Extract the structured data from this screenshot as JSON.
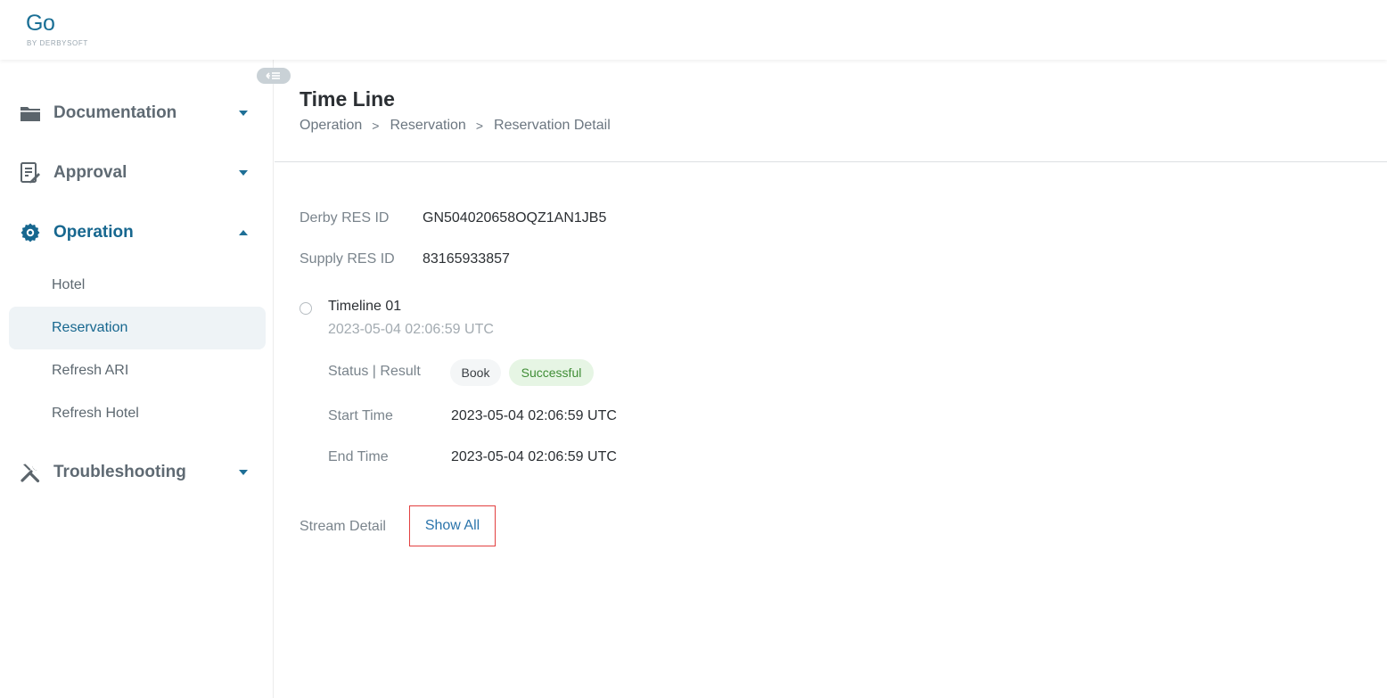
{
  "brand": {
    "logo": "Go",
    "tagline": "BY DERBYSOFT"
  },
  "sidebar": {
    "collapse_icon": "collapse-sidebar-icon",
    "groups": [
      {
        "label": "Documentation",
        "icon": "folder-icon",
        "expanded": false
      },
      {
        "label": "Approval",
        "icon": "edit-document-icon",
        "expanded": false
      },
      {
        "label": "Operation",
        "icon": "gear-icon",
        "expanded": true,
        "items": [
          {
            "label": "Hotel",
            "selected": false
          },
          {
            "label": "Reservation",
            "selected": true
          },
          {
            "label": "Refresh ARI",
            "selected": false
          },
          {
            "label": "Refresh Hotel",
            "selected": false
          }
        ]
      },
      {
        "label": "Troubleshooting",
        "icon": "tools-icon",
        "expanded": false
      }
    ]
  },
  "page": {
    "title": "Time Line",
    "breadcrumb": [
      "Operation",
      "Reservation",
      "Reservation Detail"
    ],
    "breadcrumb_separator": ">"
  },
  "details": {
    "derby_res_id_label": "Derby RES ID",
    "derby_res_id": "GN504020658OQZ1AN1JB5",
    "supply_res_id_label": "Supply RES ID",
    "supply_res_id": "83165933857"
  },
  "timeline": [
    {
      "title": "Timeline 01",
      "timestamp": "2023-05-04 02:06:59 UTC",
      "status_label": "Status | Result",
      "status": "Book",
      "result": "Successful",
      "start_label": "Start Time",
      "start_time": "2023-05-04 02:06:59 UTC",
      "end_label": "End Time",
      "end_time": "2023-05-04 02:06:59 UTC"
    }
  ],
  "stream": {
    "label": "Stream Detail",
    "action": "Show All"
  },
  "colors": {
    "accent": "#17678f",
    "success_bg": "#e6f5e4",
    "success_text": "#3f8d35",
    "highlight_border": "#e24040"
  }
}
